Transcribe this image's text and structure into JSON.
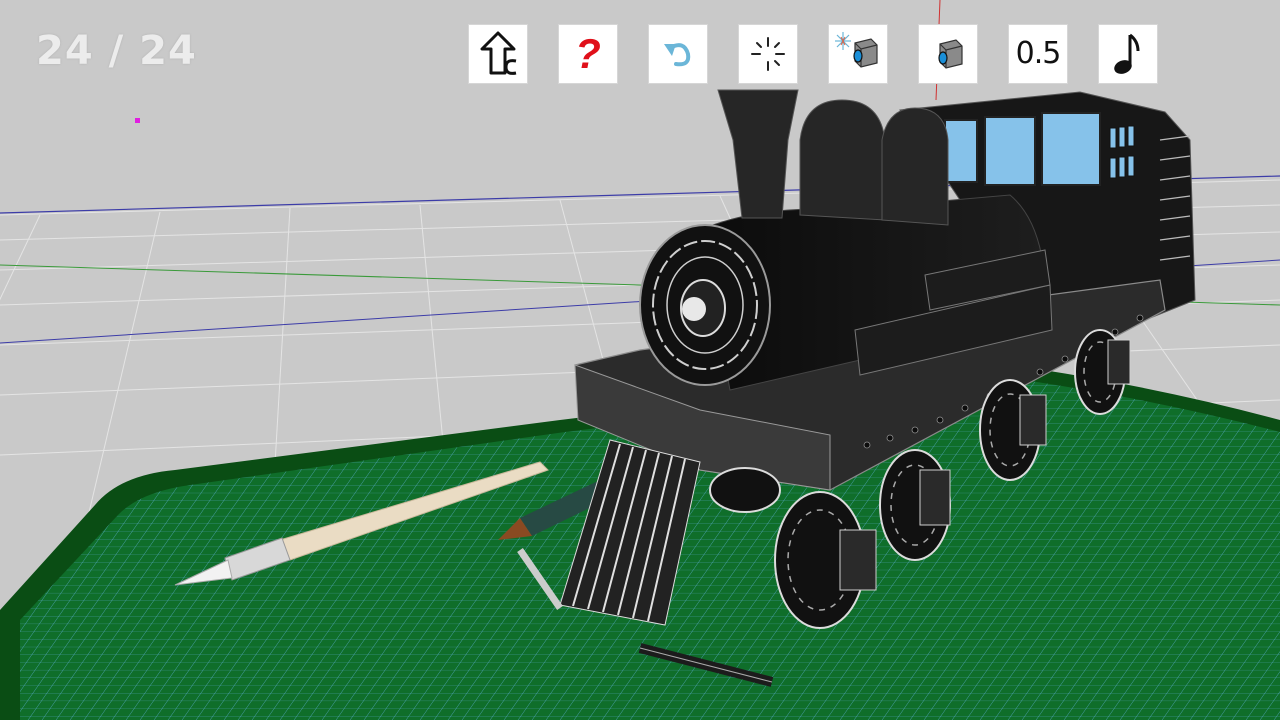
{
  "hud": {
    "counter_text": "24 / 24"
  },
  "toolbar": {
    "buttons": [
      {
        "name": "back",
        "icon": "back-arrow-icon"
      },
      {
        "name": "help",
        "icon": "question-mark-icon",
        "label": "?"
      },
      {
        "name": "undo",
        "icon": "undo-arrow-icon"
      },
      {
        "name": "sparkle",
        "icon": "sparkle-icon"
      },
      {
        "name": "lights-camera",
        "icon": "light-camera-icon"
      },
      {
        "name": "camera",
        "icon": "camera-icon"
      },
      {
        "name": "speed",
        "icon": "speed-value",
        "label": "0.5"
      },
      {
        "name": "music",
        "icon": "music-note-icon"
      }
    ]
  },
  "colors": {
    "background": "#c9c9c9",
    "cutting_mat": "#0f6e2a",
    "mat_border": "#0a4d14",
    "grid_line": "#6fb7e0",
    "train_body": "#1a1a1a",
    "help_red": "#e0101a",
    "undo_blue": "#6bb6d8",
    "cab_window": "#86c2ea"
  }
}
